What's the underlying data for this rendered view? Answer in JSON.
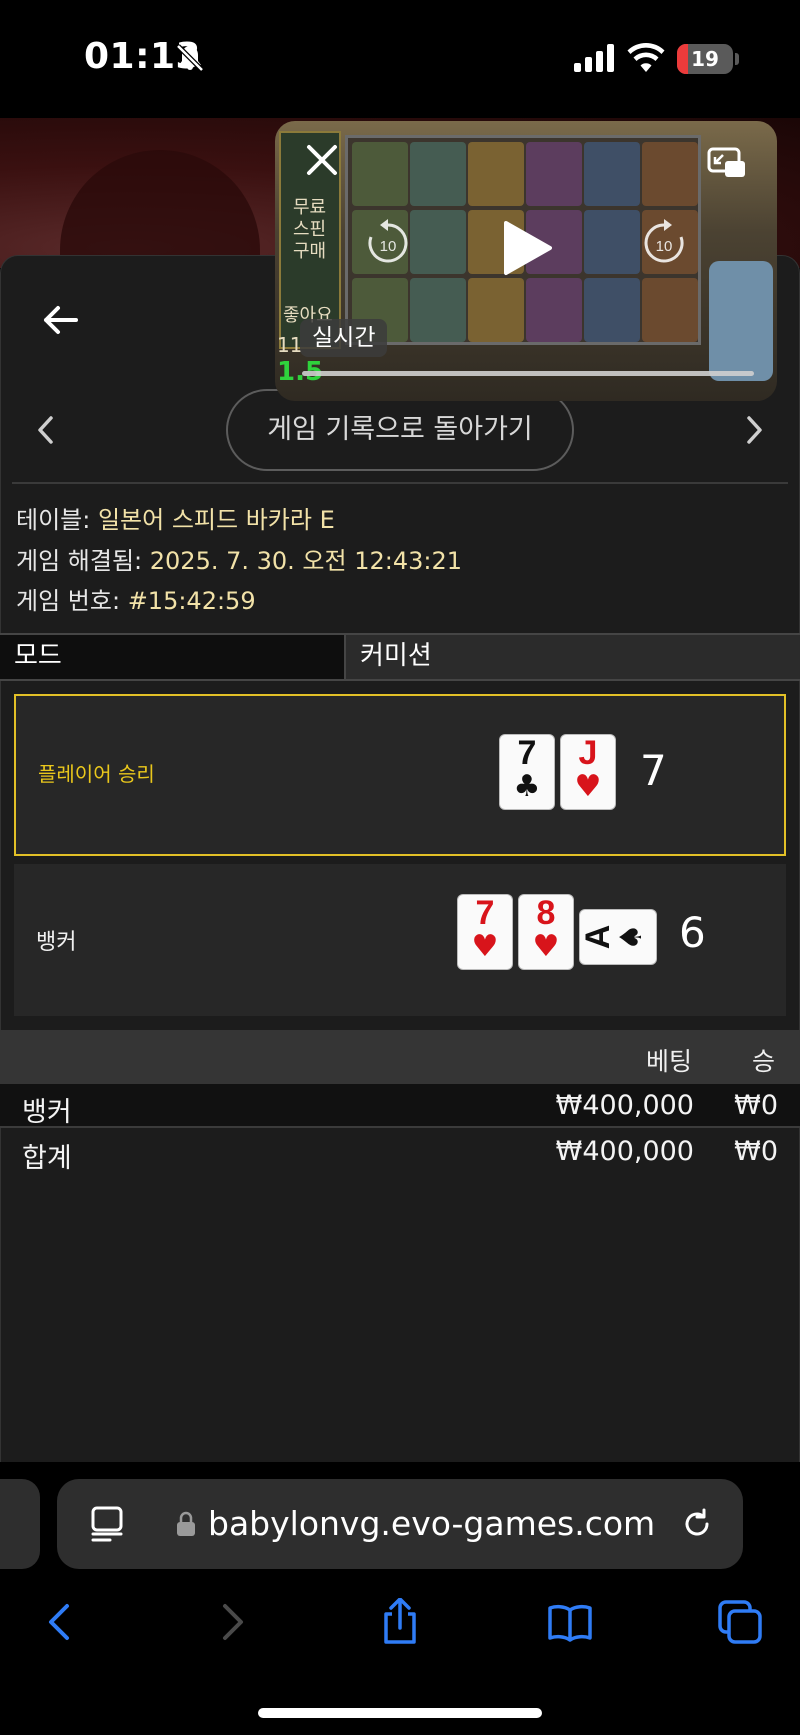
{
  "status_bar": {
    "time": "01:13",
    "battery": "19",
    "battery_level": 0.19,
    "icons": [
      "bell-slash-icon",
      "cellular-signal-icon",
      "wifi-icon",
      "battery-icon"
    ]
  },
  "pip_video": {
    "live_label": "실시간",
    "left_texts": [
      "무료",
      "스핀",
      "구매",
      "좋아요",
      "11",
      "1.5"
    ],
    "icons": [
      "close-icon",
      "picture-in-picture-icon",
      "play-icon",
      "rewind-10-icon",
      "forward-10-icon"
    ]
  },
  "header": {
    "back_to_history_label": "게임 기록으로 돌아가기"
  },
  "info": {
    "table_label": "테이블:",
    "table_value": "일본어 스피드 바카라 E",
    "resolved_label": "게임 해결됨:",
    "resolved_value": "2025. 7. 30. 오전 12:43:21",
    "number_label": "게임 번호:",
    "number_value": "#15:42:59"
  },
  "tabs": {
    "mode": "모드",
    "commission": "커미션"
  },
  "results": {
    "player": {
      "label": "플레이어 승리",
      "score": "7",
      "cards": [
        {
          "rank": "7",
          "suit": "♣",
          "color": "black"
        },
        {
          "rank": "J",
          "suit": "♥",
          "color": "red"
        }
      ]
    },
    "banker": {
      "label": "뱅커",
      "score": "6",
      "cards": [
        {
          "rank": "7",
          "suit": "♥",
          "color": "red"
        },
        {
          "rank": "8",
          "suit": "♥",
          "color": "red"
        },
        {
          "rank": "A",
          "suit": "♠",
          "color": "black"
        }
      ]
    }
  },
  "bets": {
    "header_bet": "베팅",
    "header_win": "승",
    "rows": [
      {
        "name": "뱅커",
        "bet": "₩400,000",
        "win": "₩0"
      },
      {
        "name": "합계",
        "bet": "₩400,000",
        "win": "₩0"
      }
    ]
  },
  "browser": {
    "url": "babylonvg.evo-games.com",
    "accent_color": "#2f7cf6"
  }
}
